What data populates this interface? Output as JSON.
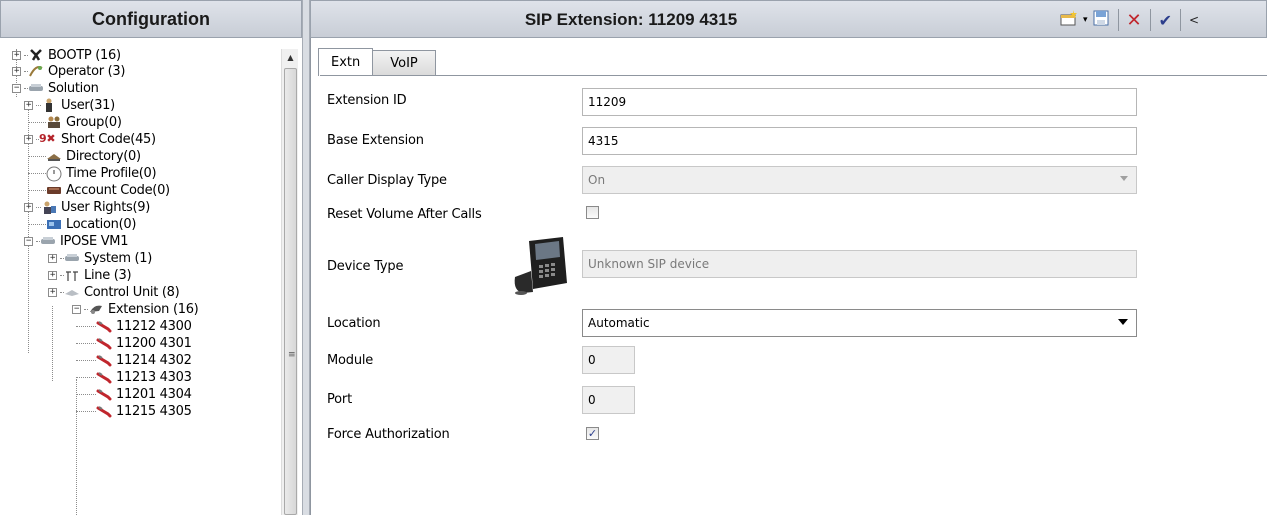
{
  "left": {
    "title": "Configuration",
    "tree": [
      {
        "label": "BOOTP (16)",
        "icon": "bootp-icon"
      },
      {
        "label": "Operator (3)",
        "icon": "operator-icon"
      },
      {
        "label": "Solution",
        "icon": "solution-icon"
      },
      {
        "label": "User(31)",
        "icon": "user-icon"
      },
      {
        "label": "Group(0)",
        "icon": "group-icon"
      },
      {
        "label": "Short Code(45)",
        "icon": "short-code-icon"
      },
      {
        "label": "Directory(0)",
        "icon": "directory-icon"
      },
      {
        "label": "Time Profile(0)",
        "icon": "clock-icon"
      },
      {
        "label": "Account Code(0)",
        "icon": "account-code-icon"
      },
      {
        "label": "User Rights(9)",
        "icon": "user-rights-icon"
      },
      {
        "label": "Location(0)",
        "icon": "location-icon"
      },
      {
        "label": "IPOSE VM1",
        "icon": "system-icon"
      },
      {
        "label": "System (1)",
        "icon": "system-icon"
      },
      {
        "label": "Line (3)",
        "icon": "line-icon"
      },
      {
        "label": "Control Unit (8)",
        "icon": "control-unit-icon"
      },
      {
        "label": "Extension (16)",
        "icon": "extension-icon"
      },
      {
        "label": "11212 4300",
        "icon": "phone-handset-icon"
      },
      {
        "label": "11200 4301",
        "icon": "phone-handset-icon"
      },
      {
        "label": "11214 4302",
        "icon": "phone-handset-icon"
      },
      {
        "label": "11213 4303",
        "icon": "phone-handset-icon"
      },
      {
        "label": "11201 4304",
        "icon": "phone-handset-icon"
      },
      {
        "label": "11215 4305",
        "icon": "phone-handset-icon"
      }
    ]
  },
  "right": {
    "title": "SIP Extension: 11209 4315",
    "toolbar": [
      "new-icon",
      "dropdown-arrow-icon",
      "save-icon",
      "delete-icon",
      "ok-check-icon",
      "back-icon"
    ],
    "tabs": [
      "Extn",
      "VoIP"
    ],
    "form": {
      "extension_id_label": "Extension ID",
      "extension_id_value": "11209",
      "base_extension_label": "Base Extension",
      "base_extension_value": "4315",
      "caller_display_label": "Caller Display Type",
      "caller_display_value": "On",
      "reset_volume_label": "Reset Volume After Calls",
      "reset_volume_checked": false,
      "device_type_label": "Device Type",
      "device_type_value": "Unknown SIP device",
      "location_label": "Location",
      "location_value": "Automatic",
      "module_label": "Module",
      "module_value": "0",
      "port_label": "Port",
      "port_value": "0",
      "force_auth_label": "Force Authorization",
      "force_auth_checked": true
    }
  },
  "colors": {
    "header_bg": "#d3d8e0",
    "handset_red": "#c0262d",
    "check_blue": "#2c3e8c"
  }
}
